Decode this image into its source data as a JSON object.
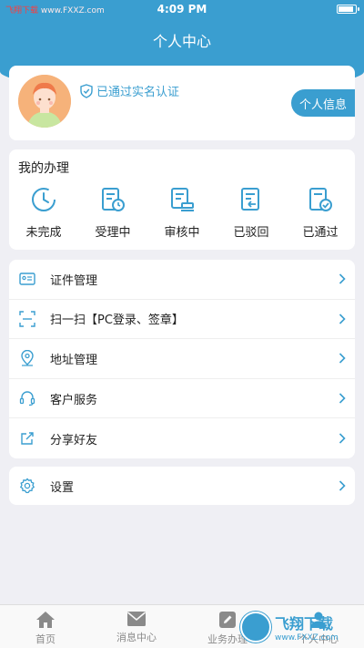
{
  "status_bar": {
    "site_label": "飞翔下载",
    "site_url": "www.FXXZ.com",
    "time": "4:09 PM"
  },
  "header": {
    "title": "个人中心"
  },
  "profile": {
    "verified_text": "已通过实名认证",
    "info_button": "个人信息"
  },
  "handling": {
    "title": "我的办理",
    "items": [
      {
        "label": "未完成",
        "icon": "clock-icon"
      },
      {
        "label": "受理中",
        "icon": "document-clock-icon"
      },
      {
        "label": "审核中",
        "icon": "document-stamp-icon"
      },
      {
        "label": "已驳回",
        "icon": "document-return-icon"
      },
      {
        "label": "已通过",
        "icon": "document-check-icon"
      }
    ]
  },
  "menu": {
    "items": [
      {
        "label": "证件管理",
        "icon": "id-card-icon"
      },
      {
        "label": "扫一扫【PC登录、签章】",
        "icon": "scan-icon"
      },
      {
        "label": "地址管理",
        "icon": "location-pin-icon"
      },
      {
        "label": "客户服务",
        "icon": "headset-icon"
      },
      {
        "label": "分享好友",
        "icon": "share-icon"
      }
    ]
  },
  "settings": {
    "label": "设置",
    "icon": "gear-icon"
  },
  "tabbar": {
    "items": [
      {
        "label": "首页",
        "icon": "home-icon"
      },
      {
        "label": "消息中心",
        "icon": "mail-icon"
      },
      {
        "label": "业务办理",
        "icon": "pencil-icon"
      },
      {
        "label": "个人中心",
        "icon": "person-icon"
      }
    ]
  },
  "watermark": {
    "line1": "飞翔下载",
    "line2": "www.FXXZ.com"
  },
  "colors": {
    "accent": "#3a9ed0",
    "background": "#efeff4"
  }
}
